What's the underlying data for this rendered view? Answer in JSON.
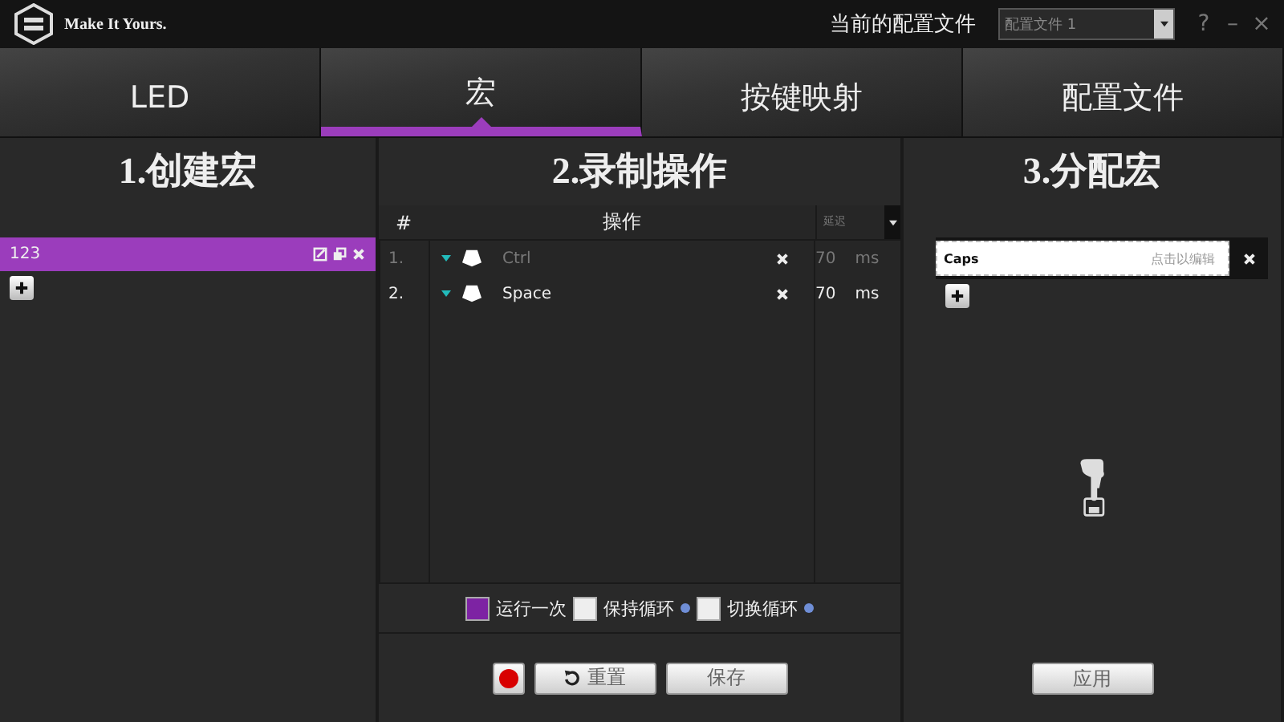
{
  "header": {
    "logo_text": "Make It Yours.",
    "profile_label": "当前的配置文件",
    "profile_value": "配置文件 1",
    "help": "?",
    "minimize": "–",
    "close": "×"
  },
  "tabs": [
    {
      "label": "LED",
      "selected": false
    },
    {
      "label": "宏",
      "selected": true
    },
    {
      "label": "按键映射",
      "selected": false
    },
    {
      "label": "配置文件",
      "selected": false
    }
  ],
  "create_panel": {
    "title": "1.创建宏",
    "macros": [
      {
        "name": "123",
        "selected": true
      }
    ]
  },
  "record_panel": {
    "title": "2.录制操作",
    "columns": [
      "#",
      "操作",
      "延迟"
    ],
    "rows": [
      {
        "index": "1.",
        "key": "Ctrl",
        "delay": "70",
        "unit": "ms",
        "active": false
      },
      {
        "index": "2.",
        "key": "Space",
        "delay": "70",
        "unit": "ms",
        "active": true
      }
    ],
    "options": [
      {
        "label": "运行一次",
        "checked": true,
        "info": false
      },
      {
        "label": "保持循环",
        "checked": false,
        "info": true
      },
      {
        "label": "切换循环",
        "checked": false,
        "info": true
      }
    ],
    "buttons": [
      {
        "kind": "record"
      },
      {
        "kind": "reset",
        "label": "重置"
      },
      {
        "kind": "plain",
        "label": "保存"
      }
    ]
  },
  "assign_panel": {
    "title": "3.分配宏",
    "bindings": [
      {
        "key": "Caps",
        "hint": "点击以编辑"
      }
    ],
    "apply": "应用"
  }
}
